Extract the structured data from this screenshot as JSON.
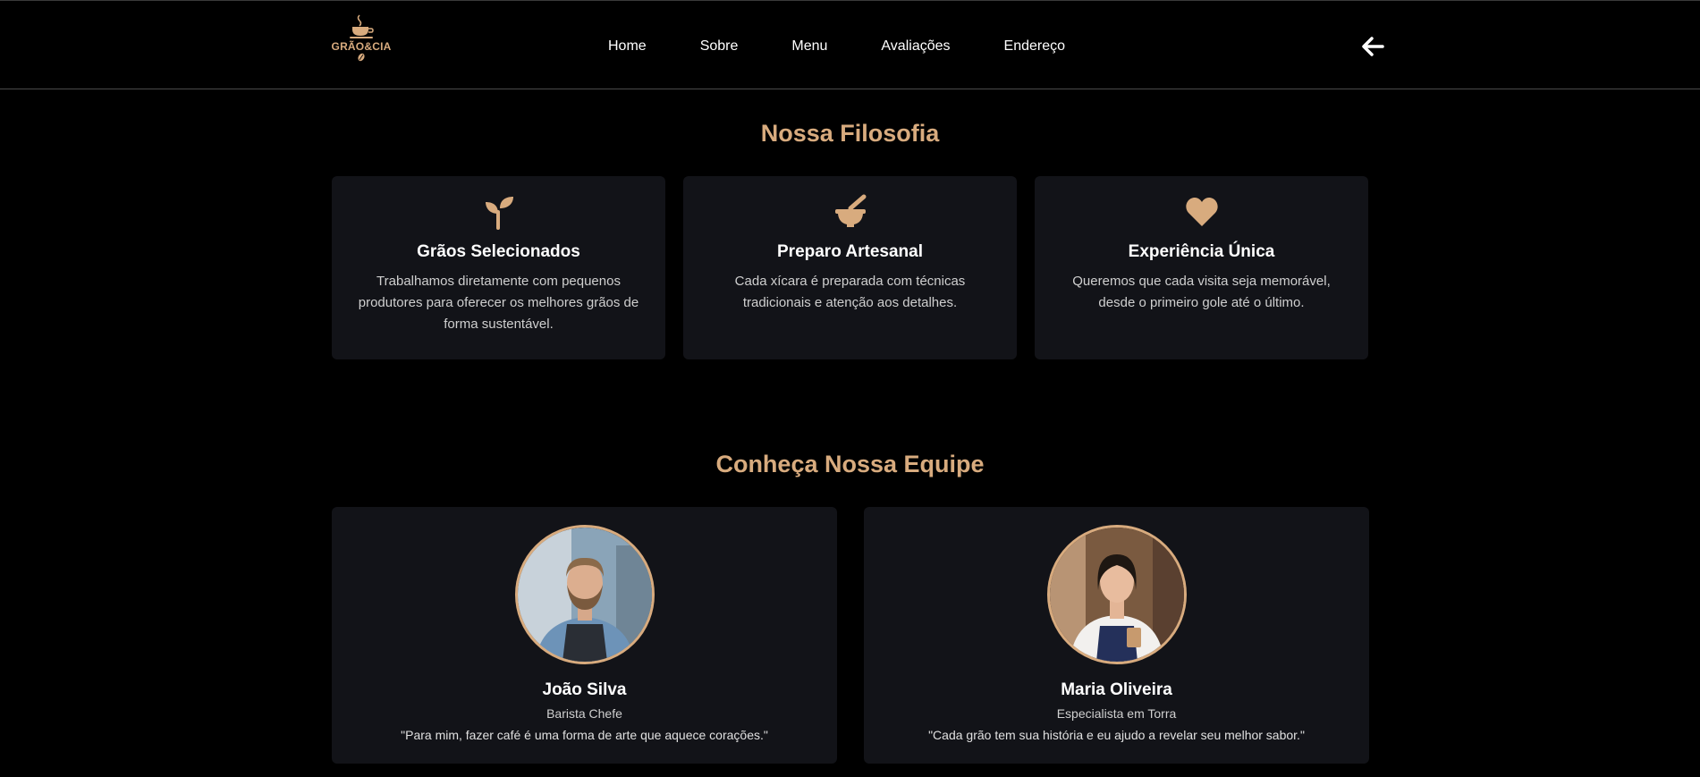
{
  "header": {
    "logo_text": "GRÃO&CIA",
    "nav": [
      "Home",
      "Sobre",
      "Menu",
      "Avaliações",
      "Endereço"
    ],
    "back_icon": "arrow-left-icon"
  },
  "philosophy": {
    "title": "Nossa Filosofia",
    "cards": [
      {
        "icon": "seedling-icon",
        "title": "Grãos Selecionados",
        "text": "Trabalhamos diretamente com pequenos produtores para oferecer os melhores grãos de forma sustentável."
      },
      {
        "icon": "mortar-pestle-icon",
        "title": "Preparo Artesanal",
        "text": "Cada xícara é preparada com técnicas tradicionais e atenção aos detalhes."
      },
      {
        "icon": "heart-icon",
        "title": "Experiência Única",
        "text": "Queremos que cada visita seja memorável, desde o primeiro gole até o último."
      }
    ]
  },
  "team": {
    "title": "Conheça Nossa Equipe",
    "members": [
      {
        "name": "João Silva",
        "role": "Barista Chefe",
        "quote": "\"Para mim, fazer café é uma forma de arte que aquece corações.\""
      },
      {
        "name": "Maria Oliveira",
        "role": "Especialista em Torra",
        "quote": "\"Cada grão tem sua história e eu ajudo a revelar seu melhor sabor.\""
      }
    ]
  },
  "colors": {
    "accent": "#d8ab7e",
    "card": "#121318",
    "background": "#000000"
  }
}
